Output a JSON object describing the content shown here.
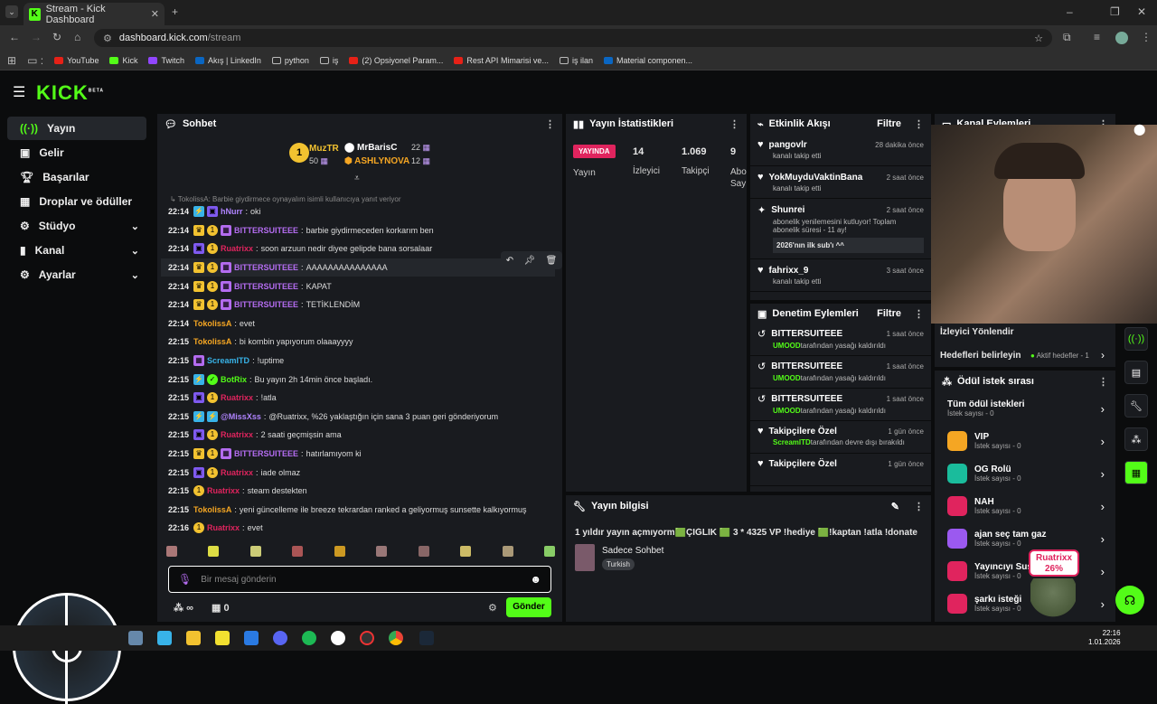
{
  "browser": {
    "tab_title": "Stream - Kick Dashboard",
    "url_host": "dashboard.kick.com",
    "url_path": "/stream",
    "bookmarks": [
      "YouTube",
      "Kick",
      "Twitch",
      "Akış | LinkedIn",
      "python",
      "iş",
      "(2) Opsiyonel Param...",
      "Rest API Mimarisi ve...",
      "iş ilan",
      "Material componen..."
    ]
  },
  "app": {
    "logo": "KICK",
    "logo_beta": "BETA"
  },
  "sidebar": {
    "items": [
      {
        "label": "Yayın",
        "icon": "broadcast-icon"
      },
      {
        "label": "Gelir",
        "icon": "wallet-icon"
      },
      {
        "label": "Başarılar",
        "icon": "trophy-icon"
      },
      {
        "label": "Droplar ve ödüller",
        "icon": "gift-icon"
      },
      {
        "label": "Stüdyo",
        "icon": "gear-icon"
      },
      {
        "label": "Kanal",
        "icon": "bars-icon"
      },
      {
        "label": "Ayarlar",
        "icon": "gear-icon"
      }
    ]
  },
  "chat": {
    "title": "Sohbet",
    "leaderboard": [
      {
        "rank": "1",
        "name": "MuzTR",
        "count": "50"
      },
      {
        "name": "MrBarisC",
        "count": "22"
      },
      {
        "name": "ASHLYNOVA",
        "count": "12"
      }
    ],
    "reply_notice": "TokolissA: Barbie giydirmece oynayalım isimli kullanıcıya yanıt veriyor",
    "messages": [
      {
        "ts": "22:14",
        "badges": [
          "blue",
          "pink"
        ],
        "user": "hNurr",
        "color": "#b084ff",
        "text": "oki"
      },
      {
        "ts": "22:14",
        "badges": [
          "crown",
          "sub",
          "gift"
        ],
        "user": "BITTERSUITEEE",
        "color": "#b46cf0",
        "text": "barbie giydirmeceden korkarım ben"
      },
      {
        "ts": "22:14",
        "badges": [
          "pink",
          "sub"
        ],
        "user": "Ruatrixx",
        "color": "#e0245e",
        "text": "soon arzuun nedir diyee gelipde bana sorsalaar"
      },
      {
        "ts": "22:14",
        "badges": [
          "crown",
          "sub",
          "gift"
        ],
        "user": "BITTERSUITEEE",
        "color": "#b46cf0",
        "text": "AAAAAAAAAAAAAAA"
      },
      {
        "ts": "22:14",
        "badges": [
          "crown",
          "sub",
          "gift"
        ],
        "user": "BITTERSUITEEE",
        "color": "#b46cf0",
        "text": "KAPAT"
      },
      {
        "ts": "22:14",
        "badges": [
          "crown",
          "sub",
          "gift"
        ],
        "user": "BITTERSUITEEE",
        "color": "#b46cf0",
        "text": "TETİKLENDİM"
      },
      {
        "ts": "22:14",
        "badges": [],
        "user": "TokolissA",
        "color": "#f5a623",
        "text": "evet"
      },
      {
        "ts": "22:15",
        "badges": [],
        "user": "TokolissA",
        "color": "#f5a623",
        "text": "bi kombin yapıyorum olaaayyyy"
      },
      {
        "ts": "22:15",
        "badges": [
          "gift"
        ],
        "user": "ScreamITD",
        "color": "#38b3e8",
        "text": "!uptime"
      },
      {
        "ts": "22:15",
        "badges": [
          "blue",
          "bot"
        ],
        "user": "BotRix",
        "color": "#53fc18",
        "text": "Bu yayın 2h 14min önce başladı."
      },
      {
        "ts": "22:15",
        "badges": [
          "pink",
          "sub"
        ],
        "user": "Ruatrixx",
        "color": "#e0245e",
        "text": "!atla"
      },
      {
        "ts": "22:15",
        "badges": [
          "blue",
          "blue"
        ],
        "user": "@MissXss",
        "color": "#b084ff",
        "text": "@Ruatrixx, %26 yaklaştığın için sana 3 puan geri gönderiyorum"
      },
      {
        "ts": "22:15",
        "badges": [
          "pink",
          "sub"
        ],
        "user": "Ruatrixx",
        "color": "#e0245e",
        "text": "2 saati geçmişsin ama"
      },
      {
        "ts": "22:15",
        "badges": [
          "crown",
          "sub",
          "gift"
        ],
        "user": "BITTERSUITEEE",
        "color": "#b46cf0",
        "text": "hatırlamıyom ki"
      },
      {
        "ts": "22:15",
        "badges": [
          "pink",
          "sub"
        ],
        "user": "Ruatrixx",
        "color": "#e0245e",
        "text": "iade olmaz"
      },
      {
        "ts": "22:15",
        "badges": [
          "sub"
        ],
        "user": "Ruatrixx",
        "color": "#e0245e",
        "text": "steam destekten"
      },
      {
        "ts": "22:15",
        "badges": [],
        "user": "TokolissA",
        "color": "#f5a623",
        "text": "yeni güncelleme ile breeze tekrardan ranked a geliyormuş sunsette kalkıyormuş"
      },
      {
        "ts": "22:16",
        "badges": [
          "sub"
        ],
        "user": "Ruatrixx",
        "color": "#e0245e",
        "text": "evet"
      }
    ],
    "input_placeholder": "Bir mesaj gönderin",
    "points": "∞",
    "gift_count": "0",
    "send_label": "Gönder"
  },
  "stats": {
    "title": "Yayın İstatistikleri",
    "live_badge": "YAYINDA",
    "live_label": "Yayın",
    "items": [
      {
        "value": "14",
        "label": "İzleyici"
      },
      {
        "value": "1.069",
        "label": "Takipçi"
      },
      {
        "value": "9",
        "label": "Abone Sayısı"
      }
    ]
  },
  "activity": {
    "title": "Etkinlik Akışı",
    "filter": "Filtre",
    "events": [
      {
        "name": "pangovlr",
        "time": "28 dakika önce",
        "desc": "kanalı takip etti"
      },
      {
        "name": "YokMuyduVaktinBana",
        "time": "2 saat önce",
        "desc": "kanalı takip etti"
      },
      {
        "name": "Shunrei",
        "time": "2 saat önce",
        "desc": "abonelik yenilemesini kutluyor! Toplam abonelik süresi - 11 ay!",
        "quote": "2026'nın ilk sub'ı ^^"
      },
      {
        "name": "fahrixx_9",
        "time": "3 saat önce",
        "desc": "kanalı takip etti"
      }
    ]
  },
  "moderation": {
    "title": "Denetim Eylemleri",
    "filter": "Filtre",
    "actions": [
      {
        "name": "BITTERSUITEEE",
        "time": "1 saat önce",
        "actor": "UMOOD",
        "desc": "tarafından yasağı kaldırıldı"
      },
      {
        "name": "BITTERSUITEEE",
        "time": "1 saat önce",
        "actor": "UMOOD",
        "desc": "tarafından yasağı kaldırıldı"
      },
      {
        "name": "BITTERSUITEEE",
        "time": "1 saat önce",
        "actor": "UMOOD",
        "desc": "tarafından yasağı kaldırıldı"
      },
      {
        "name": "Takipçilere Özel",
        "time": "1 gün önce",
        "actor": "ScreamITD",
        "desc": "tarafından devre dışı bırakıldı"
      },
      {
        "name": "Takipçilere Özel",
        "time": "1 gün önce",
        "actor": "",
        "desc": ""
      }
    ]
  },
  "stream_info": {
    "title": "Yayın bilgisi",
    "stream_title": "1 yıldır yayın açmıyorm🟩ÇIĞLIK 🟩 3 * 4325 VP !hediye 🟩!kaptan !atla !donate",
    "category": "Sadece Sohbet",
    "tag": "Turkish"
  },
  "channel": {
    "title": "Kanal Eylemleri",
    "raid_label": "İzleyici Yönlendir",
    "goals_label": "Hedefleri belirleyin",
    "goals_status": "Aktif hedefler - 1"
  },
  "rewards": {
    "title": "Ödül istek sırası",
    "items": [
      {
        "name": "Tüm ödül istekleri",
        "sub": "İstek sayısı - 0",
        "color": ""
      },
      {
        "name": "VIP",
        "sub": "İstek sayısı - 0",
        "color": "#f5a623"
      },
      {
        "name": "OG Rolü",
        "sub": "İstek sayısı - 0",
        "color": "#1abc9c"
      },
      {
        "name": "NAH",
        "sub": "İstek sayısı - 0",
        "color": "#e0245e"
      },
      {
        "name": "ajan seç tam gaz",
        "sub": "İstek sayısı - 0",
        "color": "#9b59f0"
      },
      {
        "name": "Yayıncıyı Sus",
        "sub": "İstek sayısı - 0",
        "color": "#e0245e"
      },
      {
        "name": "şarkı isteği",
        "sub": "İstek sayısı - 0",
        "color": "#e0245e"
      }
    ]
  },
  "overlay": {
    "name": "Ruatrixx",
    "percent": "26%"
  },
  "taskbar": {
    "time": "22:16",
    "date": "1.01.2026"
  }
}
